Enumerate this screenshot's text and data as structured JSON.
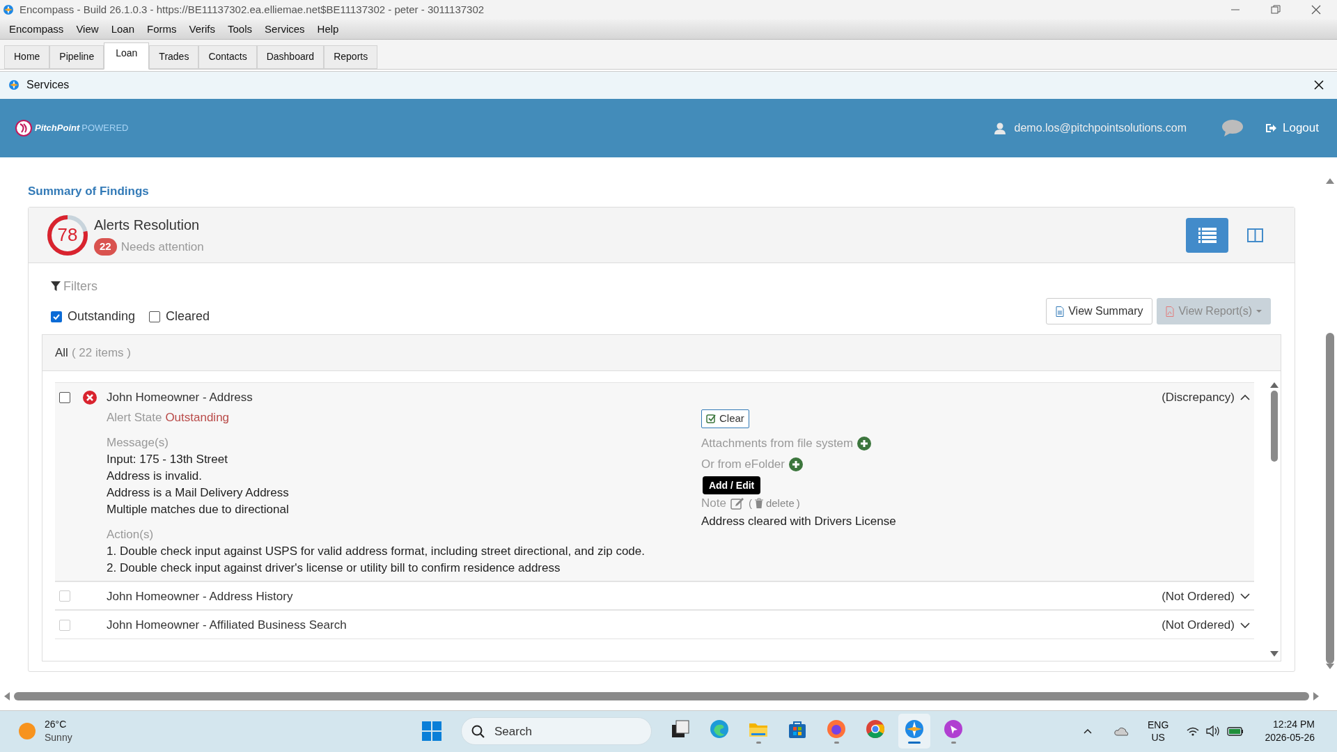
{
  "window": {
    "title": "Encompass - Build 26.1.0.3 - https://BE11137302.ea.elliemae.net$BE11137302 - peter - 3011137302"
  },
  "menu": [
    "Encompass",
    "View",
    "Loan",
    "Forms",
    "Verifs",
    "Tools",
    "Services",
    "Help"
  ],
  "tabs": [
    {
      "label": "Home",
      "selected": false
    },
    {
      "label": "Pipeline",
      "selected": false
    },
    {
      "label": "Loan",
      "selected": true
    },
    {
      "label": "Trades",
      "selected": false
    },
    {
      "label": "Contacts",
      "selected": false
    },
    {
      "label": "Dashboard",
      "selected": false
    },
    {
      "label": "Reports",
      "selected": false
    }
  ],
  "panel": {
    "title": "Services"
  },
  "header": {
    "brand": "PitchPoint",
    "brand_suffix": "POWERED",
    "user": "demo.los@pitchpointsolutions.com",
    "logout": "Logout"
  },
  "summary": {
    "title": "Summary of Findings",
    "score": "78",
    "level": 0.78,
    "heading": "Alerts Resolution",
    "count": "22",
    "status": "Needs attention",
    "views": [
      {
        "kind": "list",
        "selected": true
      },
      {
        "kind": "columns",
        "selected": false
      }
    ]
  },
  "filters": {
    "label": "Filters",
    "options": [
      {
        "label": "Outstanding",
        "checked": true
      },
      {
        "label": "Cleared",
        "checked": false
      }
    ]
  },
  "actions": [
    {
      "label": "View Summary",
      "disabled": false
    },
    {
      "label": "View Report(s)",
      "disabled": true
    }
  ],
  "list": {
    "all_label": "All",
    "count": "( 22 items )",
    "items": [
      {
        "title": "John Homeowner - Address",
        "status": "(Discrepancy)",
        "alert": true,
        "checked": false,
        "disabled": false,
        "expanded": true,
        "detail": {
          "state_label": "Alert State",
          "state": "Outstanding",
          "clear": "Clear",
          "messages_label": "Message(s)",
          "messages": [
            "Input: 175 - 13th Street",
            "Address is invalid.",
            "Address is a Mail Delivery Address",
            "Multiple matches due to directional"
          ],
          "actions_label": "Action(s)",
          "actions": [
            "1. Double check input against USPS for valid address format, including street directional, and zip code.",
            "2. Double check input against driver's license or utility bill to confirm residence address"
          ],
          "attachments_label": "Attachments from file system",
          "efolder_label": "Or from eFolder",
          "note_label": "Note",
          "delete_open": "(",
          "delete_label": "delete",
          "delete_close": ")",
          "note": "Address cleared with Drivers License",
          "tooltip": "Add / Edit"
        }
      },
      {
        "title": "John Homeowner - Address History",
        "status": "(Not Ordered)",
        "alert": false,
        "checked": false,
        "disabled": true,
        "expanded": false
      },
      {
        "title": "John Homeowner - Affiliated Business Search",
        "status": "(Not Ordered)",
        "alert": false,
        "checked": false,
        "disabled": true,
        "expanded": false
      }
    ]
  },
  "taskbar": {
    "temperature": "26°C",
    "weather": "Sunny",
    "search": "Search",
    "apps": [
      {
        "kind": "taskview",
        "running": false,
        "selected": false
      },
      {
        "kind": "edge",
        "running": false,
        "selected": false
      },
      {
        "kind": "explorer",
        "running": true,
        "selected": false
      },
      {
        "kind": "store",
        "running": false,
        "selected": false
      },
      {
        "kind": "firefox",
        "running": true,
        "selected": false
      },
      {
        "kind": "chrome",
        "running": false,
        "selected": false
      },
      {
        "kind": "encompass",
        "running": true,
        "selected": true
      },
      {
        "kind": "pointer",
        "running": true,
        "selected": false
      }
    ],
    "language": "ENG",
    "region": "US",
    "time": "12:24 PM",
    "date": "2026-05-26"
  }
}
